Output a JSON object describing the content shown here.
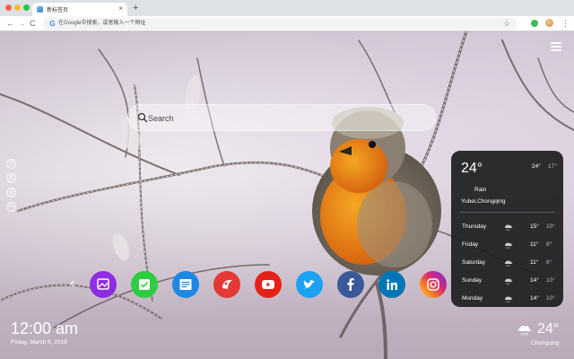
{
  "browser": {
    "tab_title": "新标签页",
    "tab_close": "×",
    "new_tab": "+",
    "omnibox_placeholder": "在Google中搜索，或者输入一个网址",
    "g_letter": "G",
    "back": "←",
    "forward": "→",
    "reload": "C",
    "star": "☆",
    "menu": "⋮"
  },
  "search": {
    "placeholder": "Search"
  },
  "side_social": [
    "f",
    "t",
    "g",
    "in"
  ],
  "dock": {
    "arrow_left": "‹",
    "apps": [
      {
        "name": "gallery",
        "color": "#8e2de2"
      },
      {
        "name": "tasks",
        "color": "#2ecc40"
      },
      {
        "name": "notes",
        "color": "#1e88e5"
      },
      {
        "name": "games",
        "color": "#e53935"
      },
      {
        "name": "youtube",
        "color": "#e62117"
      },
      {
        "name": "twitter",
        "color": "#1da1f2"
      },
      {
        "name": "facebook",
        "color": "#3b5998"
      },
      {
        "name": "linkedin",
        "color": "#0077b5"
      },
      {
        "name": "instagram",
        "color": "#c13584"
      }
    ]
  },
  "clock": {
    "time": "12:00 am",
    "date": "Friday, March 8, 2019"
  },
  "weather_corner": {
    "temp": "24°",
    "city": "Chongqing"
  },
  "weather_card": {
    "temp": "24°",
    "hi": "24°",
    "lo": "17°",
    "condition": "Rain",
    "location": "Yubei,Chongqing",
    "forecast": [
      {
        "day": "Thursday",
        "high": "15°",
        "low": "10°"
      },
      {
        "day": "Friday",
        "high": "11°",
        "low": "8°"
      },
      {
        "day": "Saturday",
        "high": "11°",
        "low": "8°"
      },
      {
        "day": "Sunday",
        "high": "14°",
        "low": "10°"
      },
      {
        "day": "Monday",
        "high": "14°",
        "low": "10°"
      }
    ]
  }
}
